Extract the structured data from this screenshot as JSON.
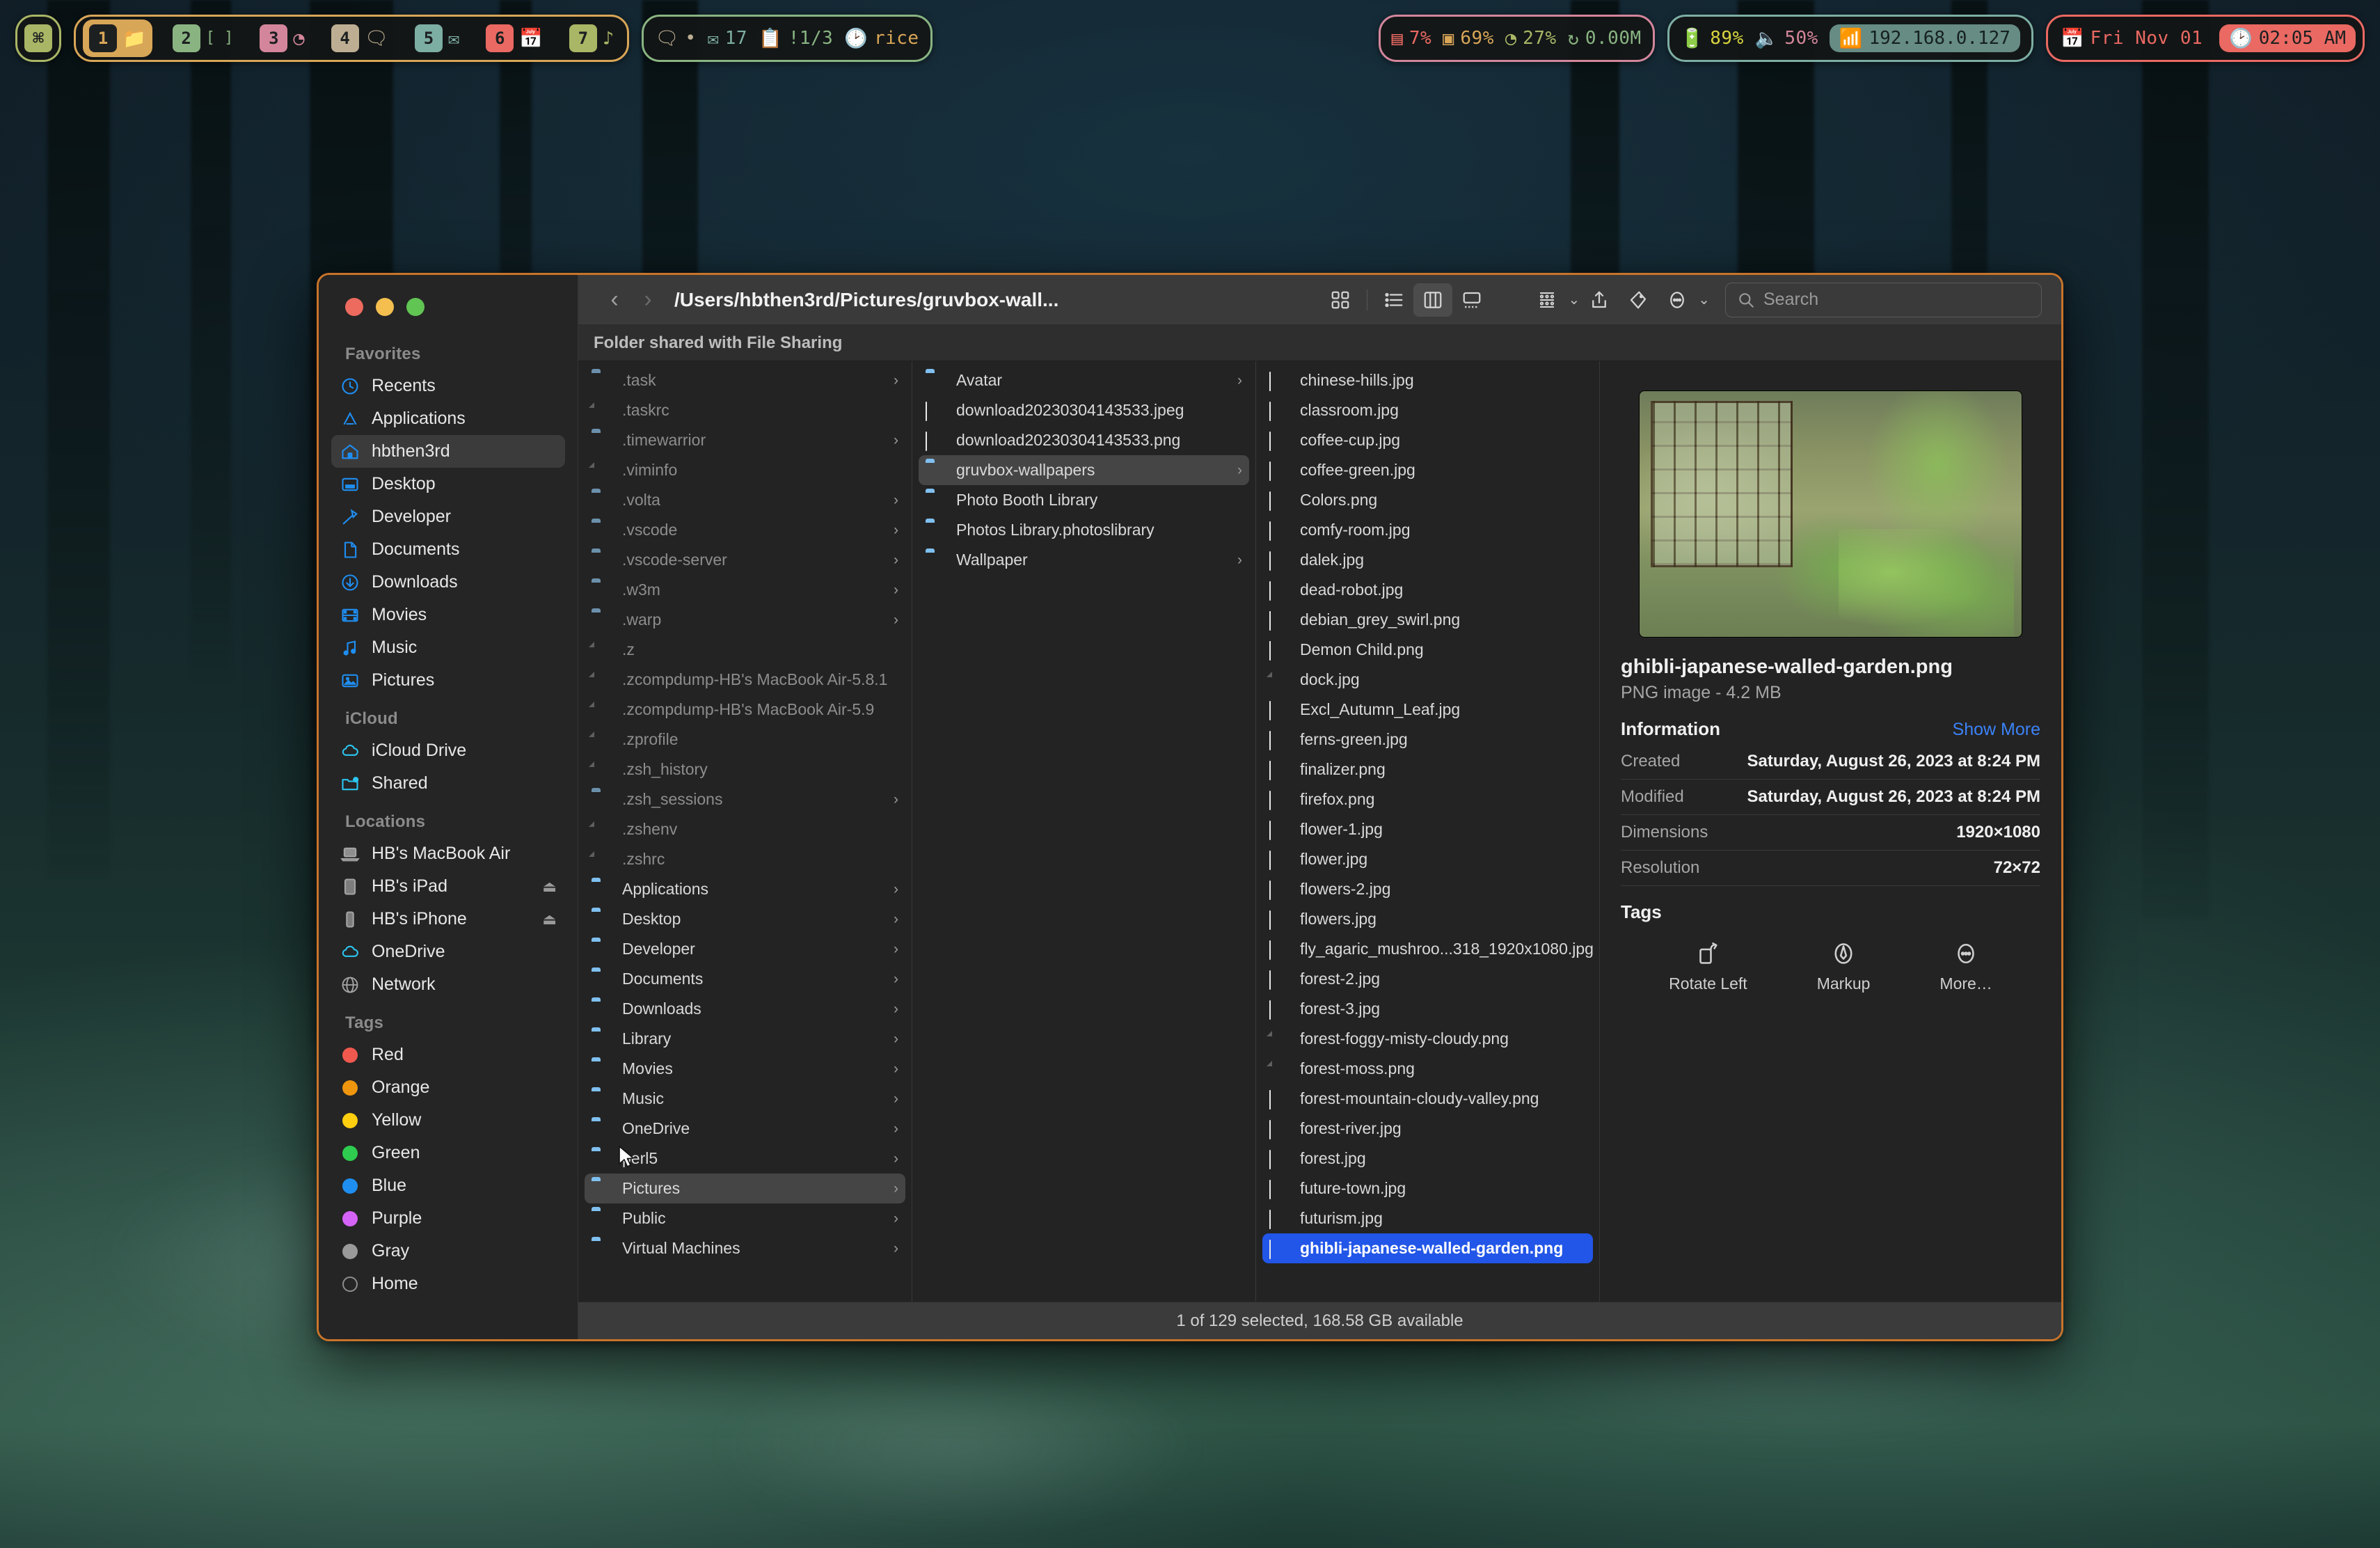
{
  "menubar": {
    "logo_glyph": "⌘",
    "spaces": [
      {
        "num": "1",
        "icon": "folder-icon",
        "glyph": "⬛",
        "color": "#d8a657",
        "active": true
      },
      {
        "num": "2",
        "icon": "terminal-icon",
        "glyph": "[ ]",
        "color": "#89b482",
        "active": false
      },
      {
        "num": "3",
        "icon": "browser-icon",
        "glyph": "◔",
        "color": "#d3869b",
        "active": false
      },
      {
        "num": "4",
        "icon": "chat-icon",
        "glyph": "💬",
        "color": "#bdae93",
        "active": false
      },
      {
        "num": "5",
        "icon": "mail-icon",
        "glyph": "✉",
        "color": "#7daea3",
        "active": false
      },
      {
        "num": "6",
        "icon": "calendar-icon",
        "glyph": "📅",
        "color": "#ea6962",
        "active": false
      },
      {
        "num": "7",
        "icon": "music-icon",
        "glyph": "♪",
        "color": "#a9b665",
        "active": false
      }
    ],
    "info": {
      "chat_icon": "chat-bubble-icon",
      "chat_value": "•",
      "mail_icon": "mail-icon",
      "mail_count": "17",
      "tasks_icon": "clipboard-icon",
      "tasks_value": "!1/3",
      "clock_icon": "clock-icon",
      "session_label": "rice"
    },
    "stats": {
      "cpu_icon": "cpu-icon",
      "cpu": "7%",
      "gpu_icon": "gpu-icon",
      "gpu": "69%",
      "disk_icon": "gauge-icon",
      "disk": "27%",
      "net_icon": "network-icon",
      "net": "0.00M"
    },
    "sys": {
      "battery_icon": "battery-icon",
      "battery": "89%",
      "volume_icon": "speaker-icon",
      "volume": "50%",
      "wifi_icon": "wifi-icon",
      "ip": "192.168.0.127"
    },
    "clock": {
      "date_icon": "calendar-icon",
      "date": "Fri Nov 01",
      "time_icon": "clock-icon",
      "time": "02:05 AM"
    }
  },
  "window": {
    "traffic": {
      "close": "close-button",
      "minimize": "minimize-button",
      "zoom": "zoom-button"
    },
    "path_title": "/Users/hbthen3rd/Pictures/gruvbox-wall...",
    "back_glyph": "‹",
    "forward_glyph": "›",
    "share_banner": "Folder shared with File Sharing",
    "status": "1 of 129 selected, 168.58 GB available",
    "search": {
      "placeholder": "Search",
      "value": ""
    },
    "view_modes": [
      "icon-view",
      "list-view",
      "column-view",
      "gallery-view"
    ],
    "active_view": "column-view",
    "accent": "#2256e8",
    "border_color": "#c8742b"
  },
  "sidebar": {
    "sections": [
      {
        "title": "Favorites",
        "items": [
          {
            "label": "Recents",
            "icon": "clock-icon",
            "selected": false
          },
          {
            "label": "Applications",
            "icon": "appstore-icon",
            "selected": false
          },
          {
            "label": "hbthen3rd",
            "icon": "home-icon",
            "selected": true
          },
          {
            "label": "Desktop",
            "icon": "desktop-icon",
            "selected": false
          },
          {
            "label": "Developer",
            "icon": "hammer-icon",
            "selected": false
          },
          {
            "label": "Documents",
            "icon": "document-icon",
            "selected": false
          },
          {
            "label": "Downloads",
            "icon": "download-icon",
            "selected": false
          },
          {
            "label": "Movies",
            "icon": "film-icon",
            "selected": false
          },
          {
            "label": "Music",
            "icon": "music-note-icon",
            "selected": false
          },
          {
            "label": "Pictures",
            "icon": "photo-icon",
            "selected": false
          }
        ]
      },
      {
        "title": "iCloud",
        "items": [
          {
            "label": "iCloud Drive",
            "icon": "cloud-icon",
            "selected": false
          },
          {
            "label": "Shared",
            "icon": "shared-folder-icon",
            "selected": false
          }
        ]
      },
      {
        "title": "Locations",
        "items": [
          {
            "label": "HB's MacBook Air",
            "icon": "laptop-icon",
            "selected": false
          },
          {
            "label": "HB's iPad",
            "icon": "ipad-icon",
            "selected": false,
            "eject": true
          },
          {
            "label": "HB's iPhone",
            "icon": "iphone-icon",
            "selected": false,
            "eject": true
          },
          {
            "label": "OneDrive",
            "icon": "cloud-icon",
            "selected": false
          },
          {
            "label": "Network",
            "icon": "globe-icon",
            "selected": false
          }
        ]
      },
      {
        "title": "Tags",
        "items": [
          {
            "label": "Red",
            "icon": "tag-dot-icon",
            "color": "#f1594f"
          },
          {
            "label": "Orange",
            "icon": "tag-dot-icon",
            "color": "#f0960e"
          },
          {
            "label": "Yellow",
            "icon": "tag-dot-icon",
            "color": "#ffcf0f"
          },
          {
            "label": "Green",
            "icon": "tag-dot-icon",
            "color": "#2ecc4f"
          },
          {
            "label": "Blue",
            "icon": "tag-dot-icon",
            "color": "#1f8ef1"
          },
          {
            "label": "Purple",
            "icon": "tag-dot-icon",
            "color": "#d663f7"
          },
          {
            "label": "Gray",
            "icon": "tag-dot-icon",
            "color": "#9a9a9a"
          },
          {
            "label": "Home",
            "icon": "tag-ring-icon",
            "color": "none"
          }
        ]
      }
    ]
  },
  "columns": [
    {
      "name": "home-column",
      "items": [
        {
          "label": ".task",
          "kind": "folder-dim",
          "arrow": true,
          "dim": true
        },
        {
          "label": ".taskrc",
          "kind": "doc",
          "arrow": false,
          "dim": true
        },
        {
          "label": ".timewarrior",
          "kind": "folder-dim",
          "arrow": true,
          "dim": true
        },
        {
          "label": ".viminfo",
          "kind": "doc",
          "arrow": false,
          "dim": true
        },
        {
          "label": ".volta",
          "kind": "folder-dim",
          "arrow": true,
          "dim": true
        },
        {
          "label": ".vscode",
          "kind": "folder-dim",
          "arrow": true,
          "dim": true
        },
        {
          "label": ".vscode-server",
          "kind": "folder-dim",
          "arrow": true,
          "dim": true
        },
        {
          "label": ".w3m",
          "kind": "folder-dim",
          "arrow": true,
          "dim": true
        },
        {
          "label": ".warp",
          "kind": "folder-dim",
          "arrow": true,
          "dim": true
        },
        {
          "label": ".z",
          "kind": "doc",
          "arrow": false,
          "dim": true
        },
        {
          "label": ".zcompdump-HB's MacBook Air-5.8.1",
          "kind": "doc",
          "arrow": false,
          "dim": true
        },
        {
          "label": ".zcompdump-HB's MacBook Air-5.9",
          "kind": "doc",
          "arrow": false,
          "dim": true
        },
        {
          "label": ".zprofile",
          "kind": "doc",
          "arrow": false,
          "dim": true
        },
        {
          "label": ".zsh_history",
          "kind": "doc",
          "arrow": false,
          "dim": true
        },
        {
          "label": ".zsh_sessions",
          "kind": "folder-dim",
          "arrow": true,
          "dim": true
        },
        {
          "label": ".zshenv",
          "kind": "doc",
          "arrow": false,
          "dim": true
        },
        {
          "label": ".zshrc",
          "kind": "doc",
          "arrow": false,
          "dim": true
        },
        {
          "label": "Applications",
          "kind": "folder",
          "arrow": true,
          "dim": false
        },
        {
          "label": "Desktop",
          "kind": "folder",
          "arrow": true,
          "dim": false
        },
        {
          "label": "Developer",
          "kind": "folder",
          "arrow": true,
          "dim": false
        },
        {
          "label": "Documents",
          "kind": "folder",
          "arrow": true,
          "dim": false
        },
        {
          "label": "Downloads",
          "kind": "folder",
          "arrow": true,
          "dim": false
        },
        {
          "label": "Library",
          "kind": "folder",
          "arrow": true,
          "dim": false
        },
        {
          "label": "Movies",
          "kind": "folder",
          "arrow": true,
          "dim": false
        },
        {
          "label": "Music",
          "kind": "folder",
          "arrow": true,
          "dim": false
        },
        {
          "label": "OneDrive",
          "kind": "folder",
          "arrow": true,
          "dim": false
        },
        {
          "label": "perl5",
          "kind": "folder",
          "arrow": true,
          "dim": false
        },
        {
          "label": "Pictures",
          "kind": "folder",
          "arrow": true,
          "dim": false,
          "highlight": true
        },
        {
          "label": "Public",
          "kind": "folder",
          "arrow": true,
          "dim": false
        },
        {
          "label": "Virtual Machines",
          "kind": "folder",
          "arrow": true,
          "dim": false
        }
      ]
    },
    {
      "name": "pictures-column",
      "items": [
        {
          "label": "Avatar",
          "kind": "folder",
          "arrow": true
        },
        {
          "label": "download20230304143533.jpeg",
          "kind": "thumb",
          "arrow": false,
          "thumb": "#5a3a82"
        },
        {
          "label": "download20230304143533.png",
          "kind": "thumb",
          "arrow": false,
          "thumb": "#5a3a82"
        },
        {
          "label": "gruvbox-wallpapers",
          "kind": "folder",
          "arrow": true,
          "highlight": true
        },
        {
          "label": "Photo Booth Library",
          "kind": "app-red",
          "arrow": false
        },
        {
          "label": "Photos Library.photoslibrary",
          "kind": "app-multi",
          "arrow": false
        },
        {
          "label": "Wallpaper",
          "kind": "folder",
          "arrow": true
        }
      ]
    },
    {
      "name": "gruvbox-wallpapers-column",
      "items": [
        {
          "label": "chinese-hills.jpg",
          "kind": "thumb",
          "thumb": "#c9bda1"
        },
        {
          "label": "classroom.jpg",
          "kind": "thumb",
          "thumb": "#8a3d1c"
        },
        {
          "label": "coffee-cup.jpg",
          "kind": "thumb",
          "thumb": "#6a5348"
        },
        {
          "label": "coffee-green.jpg",
          "kind": "thumb",
          "thumb": "#2e6b58"
        },
        {
          "label": "Colors.png",
          "kind": "thumb",
          "thumb": "#5c5248"
        },
        {
          "label": "comfy-room.jpg",
          "kind": "thumb",
          "thumb": "#4a3a28"
        },
        {
          "label": "dalek.jpg",
          "kind": "thumb",
          "thumb": "#3a2a5e"
        },
        {
          "label": "dead-robot.jpg",
          "kind": "thumb",
          "thumb": "#6e5a4e"
        },
        {
          "label": "debian_grey_swirl.png",
          "kind": "thumb",
          "thumb": "#e6e6e6"
        },
        {
          "label": "Demon Child.png",
          "kind": "thumb",
          "thumb": "#d8cdb4"
        },
        {
          "label": "dock.jpg",
          "kind": "docimg"
        },
        {
          "label": "Excl_Autumn_Leaf.jpg",
          "kind": "thumb",
          "thumb": "#4c5a3a"
        },
        {
          "label": "ferns-green.jpg",
          "kind": "thumb",
          "thumb": "#3f6b33"
        },
        {
          "label": "finalizer.png",
          "kind": "thumb",
          "thumb": "#e8e0d6"
        },
        {
          "label": "firefox.png",
          "kind": "thumb",
          "thumb": "#b24a18"
        },
        {
          "label": "flower-1.jpg",
          "kind": "thumb",
          "thumb": "#1a2230"
        },
        {
          "label": "flower.jpg",
          "kind": "thumb",
          "thumb": "#5d6a4a"
        },
        {
          "label": "flowers-2.jpg",
          "kind": "thumb",
          "thumb": "#8a4436"
        },
        {
          "label": "flowers.jpg",
          "kind": "thumb",
          "thumb": "#a8503c"
        },
        {
          "label": "fly_agaric_mushroo...318_1920x1080.jpg",
          "kind": "thumb",
          "thumb": "#4a5a36"
        },
        {
          "label": "forest-2.jpg",
          "kind": "thumb",
          "thumb": "#3a4440"
        },
        {
          "label": "forest-3.jpg",
          "kind": "thumb",
          "thumb": "#47512f"
        },
        {
          "label": "forest-foggy-misty-cloudy.png",
          "kind": "docimg"
        },
        {
          "label": "forest-moss.png",
          "kind": "docimg"
        },
        {
          "label": "forest-mountain-cloudy-valley.png",
          "kind": "thumb",
          "thumb": "#b9bec1"
        },
        {
          "label": "forest-river.jpg",
          "kind": "thumb",
          "thumb": "#3c5a52"
        },
        {
          "label": "forest.jpg",
          "kind": "thumb",
          "thumb": "#2e3a33"
        },
        {
          "label": "future-town.jpg",
          "kind": "thumb",
          "thumb": "#5a5442"
        },
        {
          "label": "futurism.jpg",
          "kind": "thumb",
          "thumb": "#8a3c52"
        },
        {
          "label": "ghibli-japanese-walled-garden.png",
          "kind": "thumb",
          "thumb": "#6f8450",
          "selected": true
        }
      ]
    }
  ],
  "preview": {
    "image_alt": "ghibli-japanese-walled-garden preview",
    "title": "ghibli-japanese-walled-garden.png",
    "subtitle": "PNG image - 4.2 MB",
    "info_title": "Information",
    "show_more": "Show More",
    "rows": [
      {
        "key": "Created",
        "value": "Saturday, August 26, 2023 at 8:24 PM"
      },
      {
        "key": "Modified",
        "value": "Saturday, August 26, 2023 at 8:24 PM"
      },
      {
        "key": "Dimensions",
        "value": "1920×1080"
      },
      {
        "key": "Resolution",
        "value": "72×72"
      }
    ],
    "tags_title": "Tags",
    "actions": [
      {
        "label": "Rotate Left",
        "icon": "rotate-left-icon"
      },
      {
        "label": "Markup",
        "icon": "markup-pen-icon"
      },
      {
        "label": "More…",
        "icon": "ellipsis-circle-icon"
      }
    ]
  }
}
